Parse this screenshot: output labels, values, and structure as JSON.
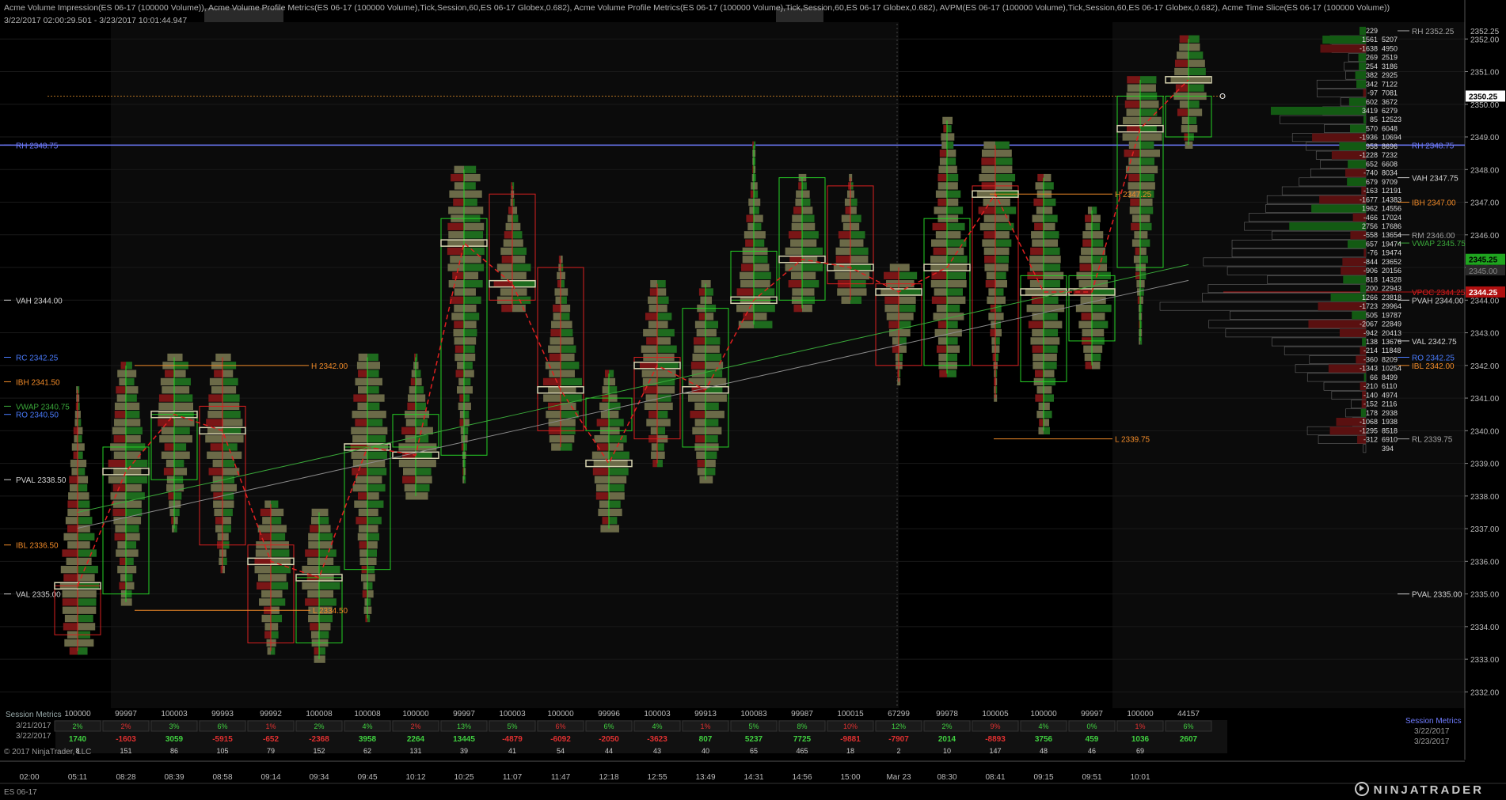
{
  "header": {
    "indicators": "Acme Volume Impression(ES 06-17 (100000 Volume)), Acme Volume Profile Metrics(ES 06-17 (100000 Volume),Tick,Session,60,ES 06-17 Globex,0.682), Acme Volume Profile Metrics(ES 06-17 (100000 Volume),Tick,Session,60,ES 06-17 Globex,0.682), AVPM(ES 06-17 (100000 Volume),Tick,Session,60,ES 06-17 Globex,0.682), Acme Time Slice(ES 06-17 (100000 Volume))",
    "range": "3/22/2017 02:00:29.501 - 3/23/2017 10:01:44.947"
  },
  "footer": {
    "copyright": "© 2017 NinjaTrader, LLC",
    "instrument": "ES 06-17",
    "brand": "NINJATRADER"
  },
  "colors": {
    "background": "#000000",
    "grid": "#1a1a1a",
    "up": "#1e6b1e",
    "down": "#7a1616",
    "neutral": "#6b6a48",
    "box_up": "#26d026",
    "box_down": "#d82020",
    "poc": "#d6d3b0",
    "price_line": "#6f7cff",
    "ib": "#f08a28",
    "vwap": "#3aa83a",
    "last_price": "#1fa51f",
    "vpoc": "#b01010"
  },
  "price_axis": {
    "min": 2331.5,
    "max": 2353.0,
    "ticks": [
      "2352.00",
      "2351.00",
      "2350.00",
      "2349.00",
      "2348.00",
      "2347.00",
      "2346.00",
      "2345.00",
      "2344.00",
      "2343.00",
      "2342.00",
      "2341.00",
      "2340.00",
      "2339.00",
      "2338.00",
      "2337.00",
      "2336.00",
      "2335.00",
      "2334.00",
      "2333.00",
      "2332.00"
    ],
    "top_label": "2352.25",
    "current_price": "2350.25",
    "last_box": "2345.25",
    "last_box2": "2345.00",
    "vpoc_box": "2344.25"
  },
  "left_levels": [
    {
      "label": "RH 2348.75",
      "price": 2348.75,
      "color": "#6f7cff"
    },
    {
      "label": "VAH 2344.00",
      "price": 2344.0,
      "color": "#d0d0d0"
    },
    {
      "label": "RC 2342.25",
      "price": 2342.25,
      "color": "#4a7cff"
    },
    {
      "label": "IBH 2341.50",
      "price": 2341.5,
      "color": "#f08a28"
    },
    {
      "label": "VWAP 2340.75",
      "price": 2340.75,
      "color": "#3aa83a"
    },
    {
      "label": "RO 2340.50",
      "price": 2340.5,
      "color": "#4a7cff"
    },
    {
      "label": "PVAL 2338.50",
      "price": 2338.5,
      "color": "#d0d0d0"
    },
    {
      "label": "IBL 2336.50",
      "price": 2336.5,
      "color": "#f08a28"
    },
    {
      "label": "VAL 2335.00",
      "price": 2335.0,
      "color": "#d0d0d0"
    }
  ],
  "right_levels": [
    {
      "label": "RH 2352.25",
      "price": 2352.25,
      "color": "#a0a0a0"
    },
    {
      "label": "RH 2348.75",
      "price": 2348.75,
      "color": "#6f7cff"
    },
    {
      "label": "VAH 2347.75",
      "price": 2347.75,
      "color": "#d0d0d0"
    },
    {
      "label": "IBH 2347.00",
      "price": 2347.0,
      "color": "#f08a28"
    },
    {
      "label": "RM 2346.00",
      "price": 2346.0,
      "color": "#a0a0a0"
    },
    {
      "label": "VWAP 2345.75",
      "price": 2345.75,
      "color": "#3aa83a"
    },
    {
      "label": "VPOC 2344.25",
      "price": 2344.25,
      "color": "#e02020"
    },
    {
      "label": "PVAH 2344.00",
      "price": 2344.0,
      "color": "#d0d0d0"
    },
    {
      "label": "VAL 2342.75",
      "price": 2342.75,
      "color": "#d0d0d0"
    },
    {
      "label": "RO 2342.25",
      "price": 2342.25,
      "color": "#4a7cff"
    },
    {
      "label": "IBL 2342.00",
      "price": 2342.0,
      "color": "#f08a28"
    },
    {
      "label": "RL 2339.75",
      "price": 2339.75,
      "color": "#a0a0a0"
    },
    {
      "label": "PVAL 2335.00",
      "price": 2335.0,
      "color": "#d0d0d0"
    }
  ],
  "profile_ladder": [
    [
      "229",
      ""
    ],
    [
      "1561",
      "5207"
    ],
    [
      "-1638",
      "4950"
    ],
    [
      "269",
      "2519"
    ],
    [
      "254",
      "3186"
    ],
    [
      "382",
      "2925"
    ],
    [
      "342",
      "7122"
    ],
    [
      "-97",
      "7081"
    ],
    [
      "602",
      "3672"
    ],
    [
      "3419",
      "6279"
    ],
    [
      "85",
      "12523"
    ],
    [
      "570",
      "6048"
    ],
    [
      "-1936",
      "10694"
    ],
    [
      "958",
      "8696"
    ],
    [
      "-1228",
      "7232"
    ],
    [
      "652",
      "6608"
    ],
    [
      "-740",
      "8034"
    ],
    [
      "679",
      "9709"
    ],
    [
      "-163",
      "12191"
    ],
    [
      "-1677",
      "14383"
    ],
    [
      "1962",
      "14556"
    ],
    [
      "-466",
      "17024"
    ],
    [
      "2756",
      "17686"
    ],
    [
      "-558",
      "13654"
    ],
    [
      "657",
      "19474"
    ],
    [
      "-76",
      "19474"
    ],
    [
      "-844",
      "23652"
    ],
    [
      "-906",
      "20156"
    ],
    [
      "818",
      "14328"
    ],
    [
      "200",
      "22943"
    ],
    [
      "1266",
      "23818"
    ],
    [
      "-1723",
      "29964"
    ],
    [
      "505",
      "19787"
    ],
    [
      "-2067",
      "22849"
    ],
    [
      "-942",
      "20413"
    ],
    [
      "138",
      "13676"
    ],
    [
      "-214",
      "11848"
    ],
    [
      "-360",
      "8209"
    ],
    [
      "-1343",
      "10254"
    ],
    [
      "66",
      "8499"
    ],
    [
      "-210",
      "6110"
    ],
    [
      "-140",
      "4974"
    ],
    [
      "-152",
      "2116"
    ],
    [
      "178",
      "2938"
    ],
    [
      "-1068",
      "1938"
    ],
    [
      "-1295",
      "8518"
    ],
    [
      "-312",
      "6910"
    ],
    [
      "",
      "394"
    ]
  ],
  "bars_volume": [
    "100000",
    "99997",
    "100003",
    "99993",
    "99992",
    "100008",
    "100008",
    "100000",
    "99997",
    "100003",
    "100000",
    "99996",
    "100003",
    "99913",
    "100083",
    "99987",
    "100015",
    "67299",
    "99978",
    "100005",
    "100000",
    "99997",
    "100000",
    "44157"
  ],
  "time_labels": [
    "02:00",
    "05:11",
    "08:28",
    "08:39",
    "08:58",
    "09:14",
    "09:34",
    "09:45",
    "10:12",
    "10:25",
    "11:07",
    "11:47",
    "12:18",
    "12:55",
    "13:49",
    "14:31",
    "14:56",
    "15:00",
    "Mar 23",
    "08:30",
    "08:41",
    "09:15",
    "09:51",
    "10:01"
  ],
  "session_metrics": {
    "title": "Session Metrics",
    "date1": "3/21/2017",
    "date2": "3/22/2017",
    "right_title": "Session Metrics",
    "right_date1": "3/22/2017",
    "right_date2": "3/23/2017",
    "row_pct": [
      "2%",
      "2%",
      "3%",
      "6%",
      "1%",
      "2%",
      "4%",
      "2%",
      "13%",
      "5%",
      "6%",
      "6%",
      "4%",
      "1%",
      "5%",
      "8%",
      "10%",
      "12%",
      "2%",
      "9%",
      "4%",
      "0%",
      "1%",
      "6%"
    ],
    "row_delta": [
      "1740",
      "-1603",
      "3059",
      "-5915",
      "-652",
      "-2368",
      "3958",
      "2264",
      "13445",
      "-4879",
      "-6092",
      "-2050",
      "-3623",
      "807",
      "5237",
      "7725",
      "-9881",
      "-7907",
      "2014",
      "-8893",
      "3756",
      "459",
      "1036",
      "2607"
    ],
    "row_count": [
      "8",
      "151",
      "86",
      "105",
      "79",
      "152",
      "62",
      "131",
      "39",
      "41",
      "54",
      "44",
      "43",
      "40",
      "65",
      "465",
      "18",
      "2",
      "10",
      "147",
      "48",
      "46",
      "69",
      ""
    ]
  },
  "bars": [
    {
      "high": 2341.25,
      "low": 2333.25,
      "up": false,
      "open": 2335.25,
      "close": 2333.75,
      "poc": 2335.25
    },
    {
      "high": 2342.0,
      "low": 2334.75,
      "up": true,
      "open": 2335.0,
      "close": 2339.5,
      "poc": 2338.75
    },
    {
      "high": 2342.25,
      "low": 2337.0,
      "up": true,
      "open": 2338.5,
      "close": 2340.5,
      "poc": 2340.5
    },
    {
      "high": 2342.25,
      "low": 2335.75,
      "up": false,
      "open": 2340.75,
      "close": 2336.5,
      "poc": 2340.0
    },
    {
      "high": 2337.75,
      "low": 2333.25,
      "up": false,
      "open": 2336.5,
      "close": 2333.5,
      "poc": 2336.0
    },
    {
      "high": 2337.5,
      "low": 2333.0,
      "up": true,
      "open": 2333.5,
      "close": 2335.5,
      "poc": 2335.5
    },
    {
      "high": 2342.25,
      "low": 2334.25,
      "up": true,
      "open": 2335.75,
      "close": 2339.5,
      "poc": 2339.5
    },
    {
      "high": 2342.25,
      "low": 2338.0,
      "up": true,
      "open": 2339.5,
      "close": 2340.5,
      "poc": 2339.25
    },
    {
      "high": 2348.0,
      "low": 2338.5,
      "up": true,
      "open": 2339.25,
      "close": 2346.5,
      "poc": 2345.75
    },
    {
      "high": 2347.5,
      "low": 2343.75,
      "up": false,
      "open": 2347.25,
      "close": 2344.0,
      "poc": 2344.5
    },
    {
      "high": 2345.25,
      "low": 2339.5,
      "up": false,
      "open": 2345.0,
      "close": 2340.0,
      "poc": 2341.25
    },
    {
      "high": 2341.75,
      "low": 2337.0,
      "up": true,
      "open": 2340.0,
      "close": 2341.0,
      "poc": 2339.0
    },
    {
      "high": 2344.5,
      "low": 2339.0,
      "up": false,
      "open": 2342.25,
      "close": 2339.75,
      "poc": 2342.0
    },
    {
      "high": 2344.5,
      "low": 2338.5,
      "up": true,
      "open": 2339.5,
      "close": 2343.75,
      "poc": 2341.25
    },
    {
      "high": 2348.75,
      "low": 2343.25,
      "up": true,
      "open": 2344.0,
      "close": 2345.5,
      "poc": 2344.0
    },
    {
      "high": 2347.75,
      "low": 2343.75,
      "up": true,
      "open": 2344.0,
      "close": 2347.75,
      "poc": 2345.25
    },
    {
      "high": 2347.75,
      "low": 2344.0,
      "up": false,
      "open": 2347.5,
      "close": 2344.5,
      "poc": 2345.0
    },
    {
      "high": 2345.0,
      "low": 2341.5,
      "up": false,
      "open": 2344.5,
      "close": 2342.0,
      "poc": 2344.25
    },
    {
      "high": 2349.5,
      "low": 2341.75,
      "up": true,
      "open": 2342.0,
      "close": 2346.5,
      "poc": 2345.0
    },
    {
      "high": 2348.75,
      "low": 2341.0,
      "up": false,
      "open": 2347.5,
      "close": 2342.0,
      "poc": 2347.25
    },
    {
      "high": 2347.75,
      "low": 2340.0,
      "up": true,
      "open": 2341.5,
      "close": 2344.75,
      "poc": 2344.25
    },
    {
      "high": 2346.75,
      "low": 2342.0,
      "up": true,
      "open": 2342.75,
      "close": 2344.75,
      "poc": 2344.25
    },
    {
      "high": 2350.75,
      "low": 2342.75,
      "up": true,
      "open": 2345.0,
      "close": 2350.25,
      "poc": 2349.25
    },
    {
      "high": 2352.0,
      "low": 2348.75,
      "up": true,
      "open": 2349.0,
      "close": 2350.25,
      "poc": 2350.75
    }
  ],
  "markers": {
    "h_2342": "H 2342.00",
    "h_2347": "H 2347.25",
    "l_2339": "L 2339.75",
    "l_2334": "L 2334.50"
  }
}
